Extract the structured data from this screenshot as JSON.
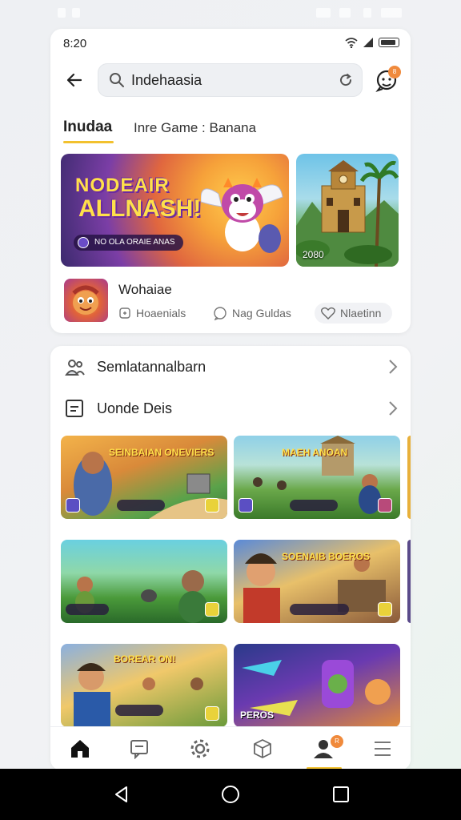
{
  "status": {
    "time": "8:20"
  },
  "search": {
    "value": "Indehaasia"
  },
  "notification_badge": "8",
  "tabs": [
    {
      "label": "Inudaa"
    },
    {
      "label": "Inre Game : Banana"
    }
  ],
  "banners": [
    {
      "title_line1": "NODEAIR",
      "title_line2": "ALLNASH!",
      "pill": "NO OLA ORAIE ANAS"
    },
    {
      "label": "2080"
    }
  ],
  "featured_game": {
    "name": "Wohaiae",
    "meta": [
      {
        "label": "Hoaenials",
        "icon": "gamepad-icon"
      },
      {
        "label": "Nag Guldas",
        "icon": "chat-icon"
      },
      {
        "label": "Nlaetinn",
        "icon": "heart-icon"
      }
    ]
  },
  "sections": [
    {
      "label": "Semlatannalbarn",
      "icon": "people-icon"
    },
    {
      "label": "Uonde Deis",
      "icon": "list-icon"
    }
  ],
  "tiles": [
    {
      "title": "SEINBAIAN ONEVIERS"
    },
    {
      "title": "MAEH ANOAN"
    },
    {
      "title": ""
    },
    {
      "title": "SOENAIB BOEROS"
    },
    {
      "title": "BOREAR ON!"
    },
    {
      "title": "PEROS"
    }
  ],
  "bottom_nav": {
    "items": [
      "home-icon",
      "message-icon",
      "settings-icon",
      "cube-icon",
      "profile-icon",
      "menu-icon"
    ],
    "badge": "R",
    "active": "profile-icon"
  },
  "colors": {
    "accent": "#f2c12e",
    "badge": "#f08a3c"
  }
}
